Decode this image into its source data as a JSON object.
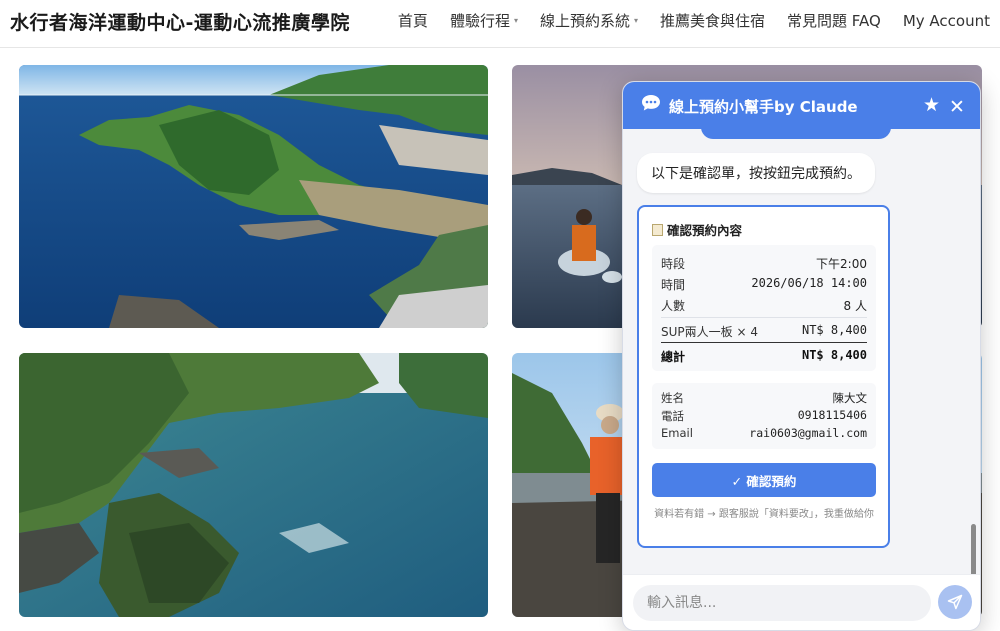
{
  "site": {
    "title": "水行者海洋運動中心-運動心流推廣學院"
  },
  "nav": {
    "items": [
      {
        "label": "首頁",
        "has_dropdown": false
      },
      {
        "label": "體驗行程",
        "has_dropdown": true
      },
      {
        "label": "線上預約系統",
        "has_dropdown": true
      },
      {
        "label": "推薦美食與住宿",
        "has_dropdown": false
      },
      {
        "label": "常見問題 FAQ",
        "has_dropdown": false
      },
      {
        "label": "My Account",
        "has_dropdown": false
      }
    ],
    "dropdown_icon": "chevron-down-icon"
  },
  "gallery": {
    "photos": [
      {
        "subject": "aerial coastline harbor"
      },
      {
        "subject": "paddleboard at sunset"
      },
      {
        "subject": "aerial rocky cove"
      },
      {
        "subject": "hiker on beach"
      }
    ]
  },
  "chat": {
    "title": "線上預約小幫手by Claude",
    "icons": {
      "chat": "chat-bubble-icon",
      "favorite": "star-icon",
      "close": "close-icon",
      "send": "send-icon"
    },
    "bot_message": "以下是確認單，按按鈕完成預約。",
    "card": {
      "title": "確認預約內容",
      "title_icon": "clipboard-icon",
      "booking": {
        "slot_label": "時段",
        "slot_value": "下午2:00",
        "time_label": "時間",
        "time_value": "2026/06/18 14:00",
        "people_label": "人數",
        "people_value": "8 人",
        "item_label": "SUP兩人一板 × 4",
        "item_value": "NT$ 8,400",
        "total_label": "總計",
        "total_value": "NT$ 8,400"
      },
      "contact": {
        "name_label": "姓名",
        "name_value": "陳大文",
        "phone_label": "電話",
        "phone_value": "0918115406",
        "email_label": "Email",
        "email_value": "rai0603@gmail.com"
      },
      "confirm_button": "✓ 確認預約",
      "note": "資料若有錯 → 跟客服說「資料要改」，我重做給你"
    },
    "input": {
      "value": "",
      "placeholder": "輸入訊息..."
    }
  },
  "colors": {
    "accent": "#4a7fe8",
    "send_button": "#a9c1f1",
    "card_border": "#4a7fe8"
  }
}
